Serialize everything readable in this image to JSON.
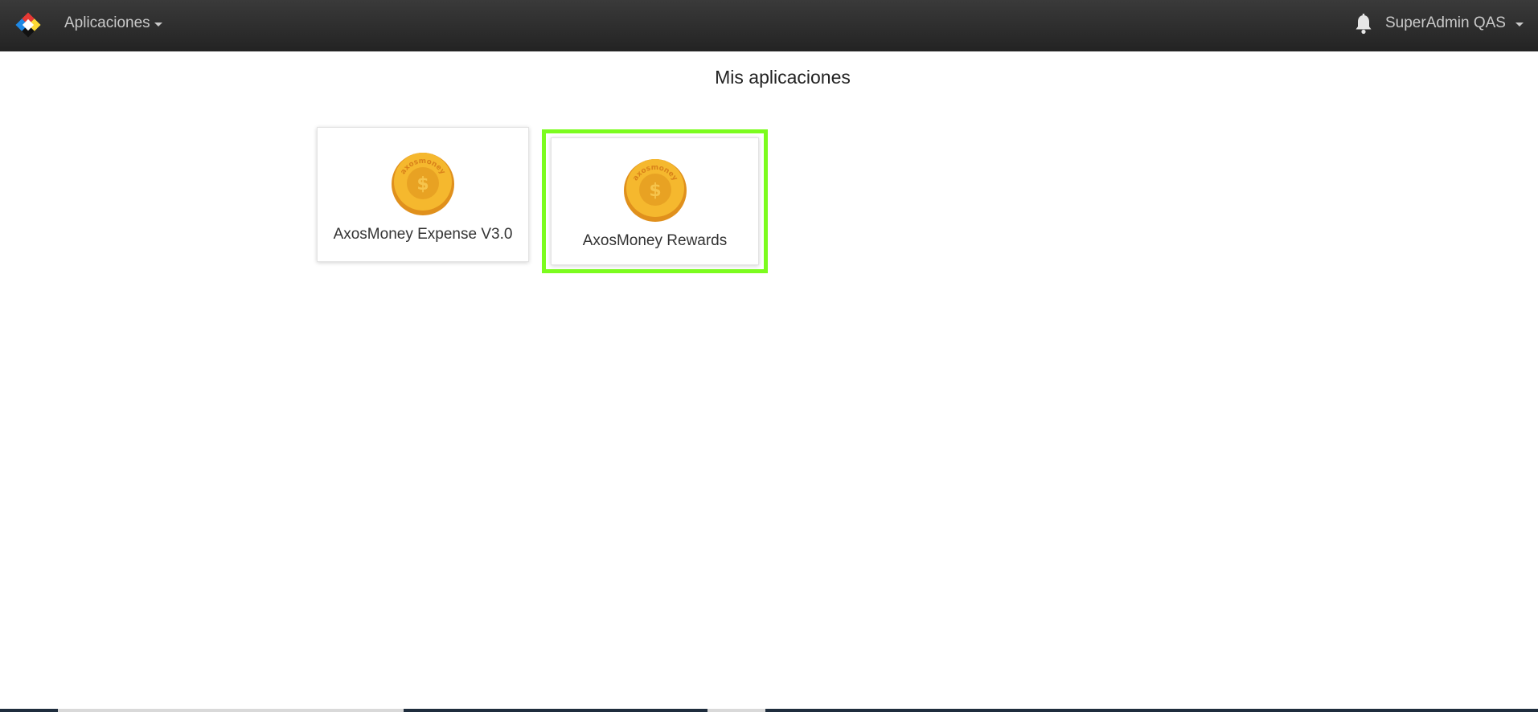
{
  "navbar": {
    "apps_menu_label": "Aplicaciones",
    "user_label": "SuperAdmin QAS"
  },
  "page": {
    "title": "Mis aplicaciones"
  },
  "apps": [
    {
      "name": "AxosMoney Expense V3.0",
      "logo_text": "axosmoney",
      "selected": false
    },
    {
      "name": "AxosMoney Rewards",
      "logo_text": "axosmoney",
      "selected": true
    }
  ],
  "colors": {
    "navbar": "#2b2b2b",
    "nav_text": "#c9c9c9",
    "highlight": "#7cfc1e",
    "coin_gold": "#f5b82e",
    "coin_dark": "#e0901c"
  }
}
